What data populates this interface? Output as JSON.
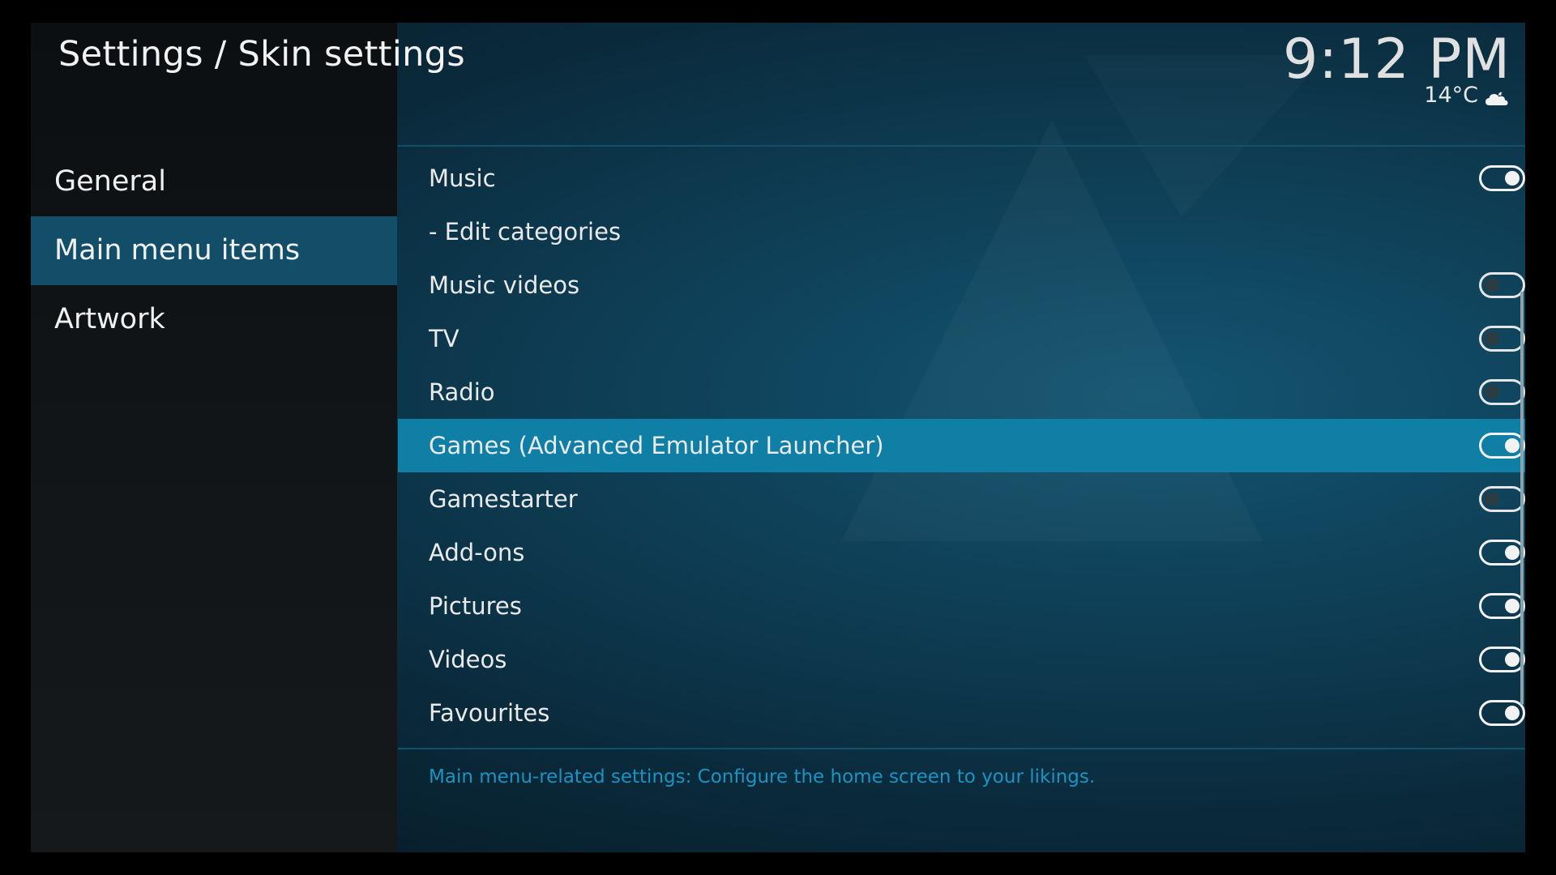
{
  "header": {
    "title": "Settings / Skin settings"
  },
  "status": {
    "time": "9:12 PM",
    "temperature": "14°C",
    "weather_icon": "cloud-night-icon"
  },
  "sidebar": {
    "items": [
      {
        "label": "General",
        "active": false
      },
      {
        "label": "Main menu items",
        "active": true
      },
      {
        "label": "Artwork",
        "active": false
      }
    ]
  },
  "settings": {
    "items": [
      {
        "label": "Music",
        "toggle": true,
        "enabled": true,
        "focused": false
      },
      {
        "label": "- Edit categories",
        "toggle": false,
        "enabled": null,
        "focused": false
      },
      {
        "label": "Music videos",
        "toggle": true,
        "enabled": false,
        "focused": false
      },
      {
        "label": "TV",
        "toggle": true,
        "enabled": false,
        "focused": false
      },
      {
        "label": "Radio",
        "toggle": true,
        "enabled": false,
        "focused": false
      },
      {
        "label": "Games (Advanced Emulator Launcher)",
        "toggle": true,
        "enabled": true,
        "focused": true
      },
      {
        "label": "Gamestarter",
        "toggle": true,
        "enabled": false,
        "focused": false
      },
      {
        "label": "Add-ons",
        "toggle": true,
        "enabled": true,
        "focused": false
      },
      {
        "label": "Pictures",
        "toggle": true,
        "enabled": true,
        "focused": false
      },
      {
        "label": "Videos",
        "toggle": true,
        "enabled": true,
        "focused": false
      },
      {
        "label": "Favourites",
        "toggle": true,
        "enabled": true,
        "focused": false
      }
    ]
  },
  "description": "Main menu-related settings: Configure the home screen to your likings.",
  "colors": {
    "focus": "#107fa5",
    "sidebar_active": "#124e67",
    "description_text": "#1b93c3"
  }
}
